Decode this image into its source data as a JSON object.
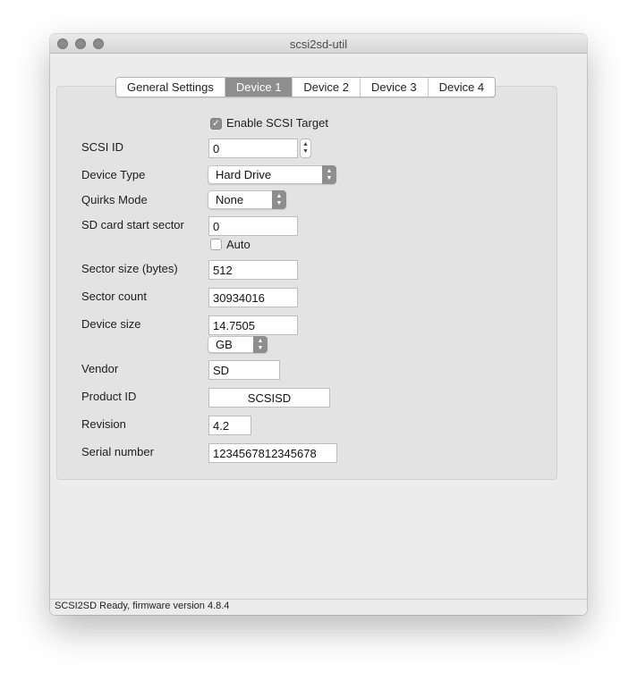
{
  "window": {
    "title": "scsi2sd-util"
  },
  "tabs": [
    {
      "label": "General Settings",
      "active": false
    },
    {
      "label": "Device 1",
      "active": true
    },
    {
      "label": "Device 2",
      "active": false
    },
    {
      "label": "Device 3",
      "active": false
    },
    {
      "label": "Device 4",
      "active": false
    }
  ],
  "form": {
    "enable_target": {
      "label": "Enable SCSI Target",
      "checked": true
    },
    "scsi_id": {
      "label": "SCSI ID",
      "value": "0"
    },
    "device_type": {
      "label": "Device Type",
      "value": "Hard Drive"
    },
    "quirks_mode": {
      "label": "Quirks Mode",
      "value": "None"
    },
    "sd_start_sector": {
      "label": "SD card start sector",
      "value": "0"
    },
    "auto": {
      "label": "Auto",
      "checked": false
    },
    "sector_size": {
      "label": "Sector size (bytes)",
      "value": "512"
    },
    "sector_count": {
      "label": "Sector count",
      "value": "30934016"
    },
    "device_size": {
      "label": "Device size",
      "value": "14.7505",
      "unit": "GB"
    },
    "vendor": {
      "label": "Vendor",
      "value": "SD"
    },
    "product_id": {
      "label": "Product ID",
      "value": "SCSISD"
    },
    "revision": {
      "label": "Revision",
      "value": "4.2"
    },
    "serial_number": {
      "label": "Serial number",
      "value": "1234567812345678"
    }
  },
  "status": {
    "text": "SCSI2SD Ready, firmware version 4.8.4"
  },
  "colors": {
    "window_bg": "#ececec",
    "panel_bg": "#e3e3e3",
    "selected_tab": "#8e8e8e"
  }
}
